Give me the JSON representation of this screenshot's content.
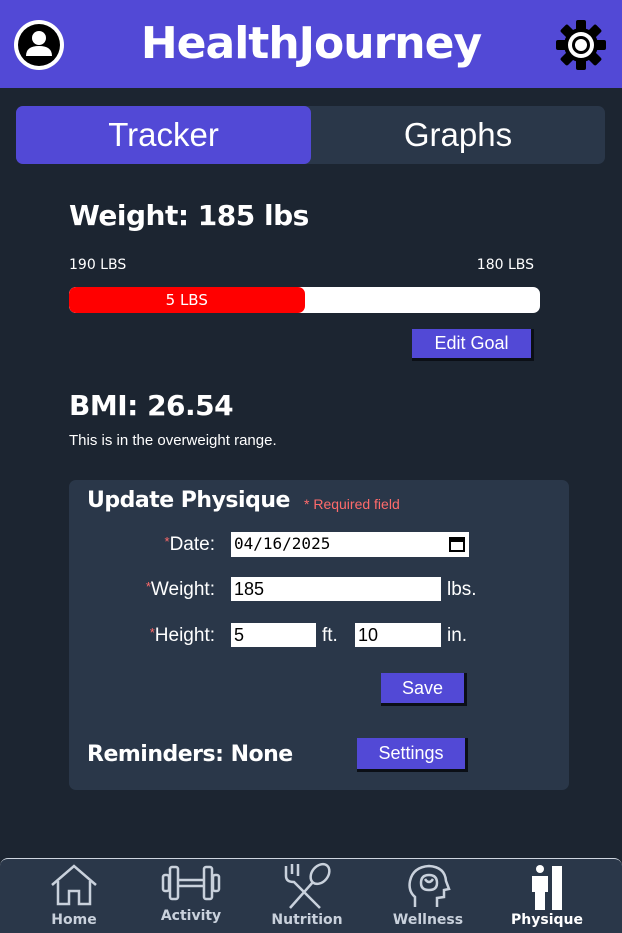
{
  "header": {
    "title": "HealthJourney",
    "profile_icon": "profile-icon",
    "settings_icon": "gear-icon"
  },
  "tabs": [
    {
      "label": "Tracker",
      "active": true
    },
    {
      "label": "Graphs",
      "active": false
    }
  ],
  "weight": {
    "title": "Weight: 185 lbs",
    "start_label": "190 LBS",
    "goal_label": "180 LBS",
    "progress_label": "5 LBS",
    "progress_fraction": 0.5,
    "edit_goal_label": "Edit Goal"
  },
  "bmi": {
    "title": "BMI: 26.54",
    "note": "This is in the overweight range."
  },
  "form": {
    "title": "Update Physique",
    "required_note": "* Required field",
    "required_star": "*",
    "date_label": "Date:",
    "date_value": "04/16/2025",
    "weight_label": "Weight:",
    "weight_value": "185",
    "weight_unit": "lbs.",
    "height_label": "Height:",
    "height_ft_value": "5",
    "height_ft_unit": "ft.",
    "height_in_value": "10",
    "height_in_unit": "in.",
    "save_label": "Save",
    "reminders_label": "Reminders:",
    "reminders_value": "None",
    "settings_label": "Settings"
  },
  "nav": [
    {
      "label": "Home",
      "icon": "home-icon"
    },
    {
      "label": "Activity",
      "icon": "dumbbell-icon"
    },
    {
      "label": "Nutrition",
      "icon": "fork-spoon-icon"
    },
    {
      "label": "Wellness",
      "icon": "brain-icon"
    },
    {
      "label": "Physique",
      "icon": "body-icon",
      "active": true
    }
  ],
  "colors": {
    "accent": "#5249d6",
    "background": "#1c2531",
    "panel": "#2a3749",
    "progress": "#ff0000",
    "required": "#ff6b6b"
  }
}
